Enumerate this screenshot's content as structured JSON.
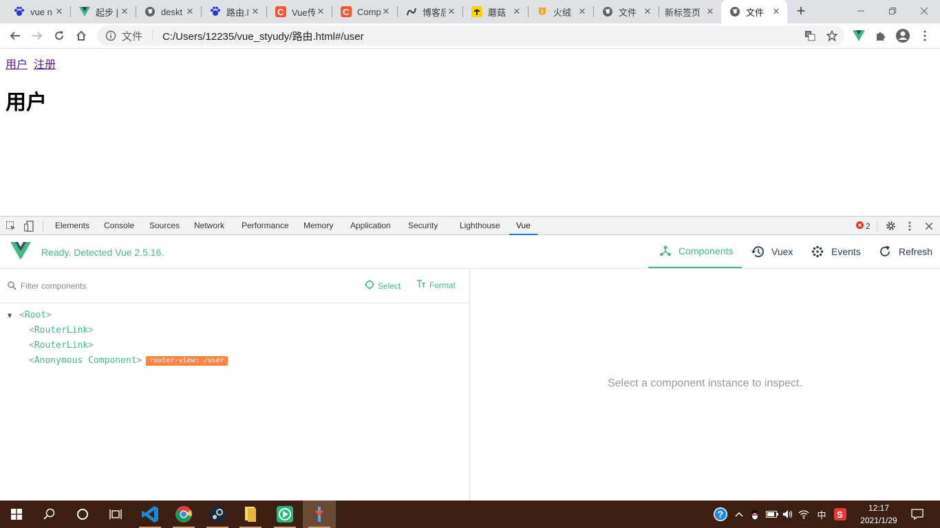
{
  "browser": {
    "tabs": [
      {
        "title": "vue n",
        "icon": "baidu-paw-icon",
        "active": false
      },
      {
        "title": "起步 |",
        "icon": "vue-logo-icon",
        "active": false
      },
      {
        "title": "deskt",
        "icon": "globe-icon",
        "active": false
      },
      {
        "title": "路由.l",
        "icon": "baidu-paw-icon",
        "active": false
      },
      {
        "title": "Vue传",
        "icon": "csdn-icon",
        "active": false
      },
      {
        "title": "Comp",
        "icon": "csdn-icon",
        "active": false
      },
      {
        "title": "博客后",
        "icon": "cnblogs-icon",
        "active": false
      },
      {
        "title": "蘑菇",
        "icon": "mushroom-icon",
        "active": false
      },
      {
        "title": "火绒",
        "icon": "huorong-icon",
        "active": false
      },
      {
        "title": "文件",
        "icon": "globe-icon",
        "active": false
      },
      {
        "title": "新标签页",
        "icon": "",
        "active": false
      },
      {
        "title": "文件",
        "icon": "globe-icon",
        "active": true
      }
    ],
    "new_tab_symbol": "+",
    "omnibox": {
      "scheme": "文件",
      "url": "C:/Users/12235/vue_styudy/路由.html#/user"
    }
  },
  "page": {
    "links": [
      "用户",
      "注册"
    ],
    "heading": "用户"
  },
  "devtools": {
    "tabs": [
      "Elements",
      "Console",
      "Sources",
      "Network",
      "Performance",
      "Memory",
      "Application",
      "Security",
      "Lighthouse",
      "Vue"
    ],
    "active_tab": "Vue",
    "error_count": "2",
    "vue": {
      "status": "Ready. Detected Vue 2.5.16.",
      "nav": [
        {
          "label": "Components",
          "icon": "components-icon",
          "active": true
        },
        {
          "label": "Vuex",
          "icon": "history-icon",
          "active": false
        },
        {
          "label": "Events",
          "icon": "events-icon",
          "active": false
        },
        {
          "label": "Refresh",
          "icon": "refresh-icon",
          "active": false
        }
      ],
      "filter_placeholder": "Filter components",
      "select_label": "Select",
      "format_label": "Format",
      "tree": {
        "root": "Root",
        "children": [
          "RouterLink",
          "RouterLink",
          "Anonymous Component"
        ],
        "badge": "router-view: /user"
      },
      "inspect_message": "Select a component instance to inspect."
    }
  },
  "taskbar": {
    "apps": [
      "start-icon",
      "search-icon",
      "cortana-icon",
      "task-view-icon",
      "vscode-icon",
      "chrome-icon",
      "steam-icon",
      "file-explorer-icon",
      "media-player-icon",
      "tool-icon"
    ],
    "ime": "中",
    "time": "12:17",
    "date": "2021/1/29",
    "accent": "#3b1f10"
  }
}
